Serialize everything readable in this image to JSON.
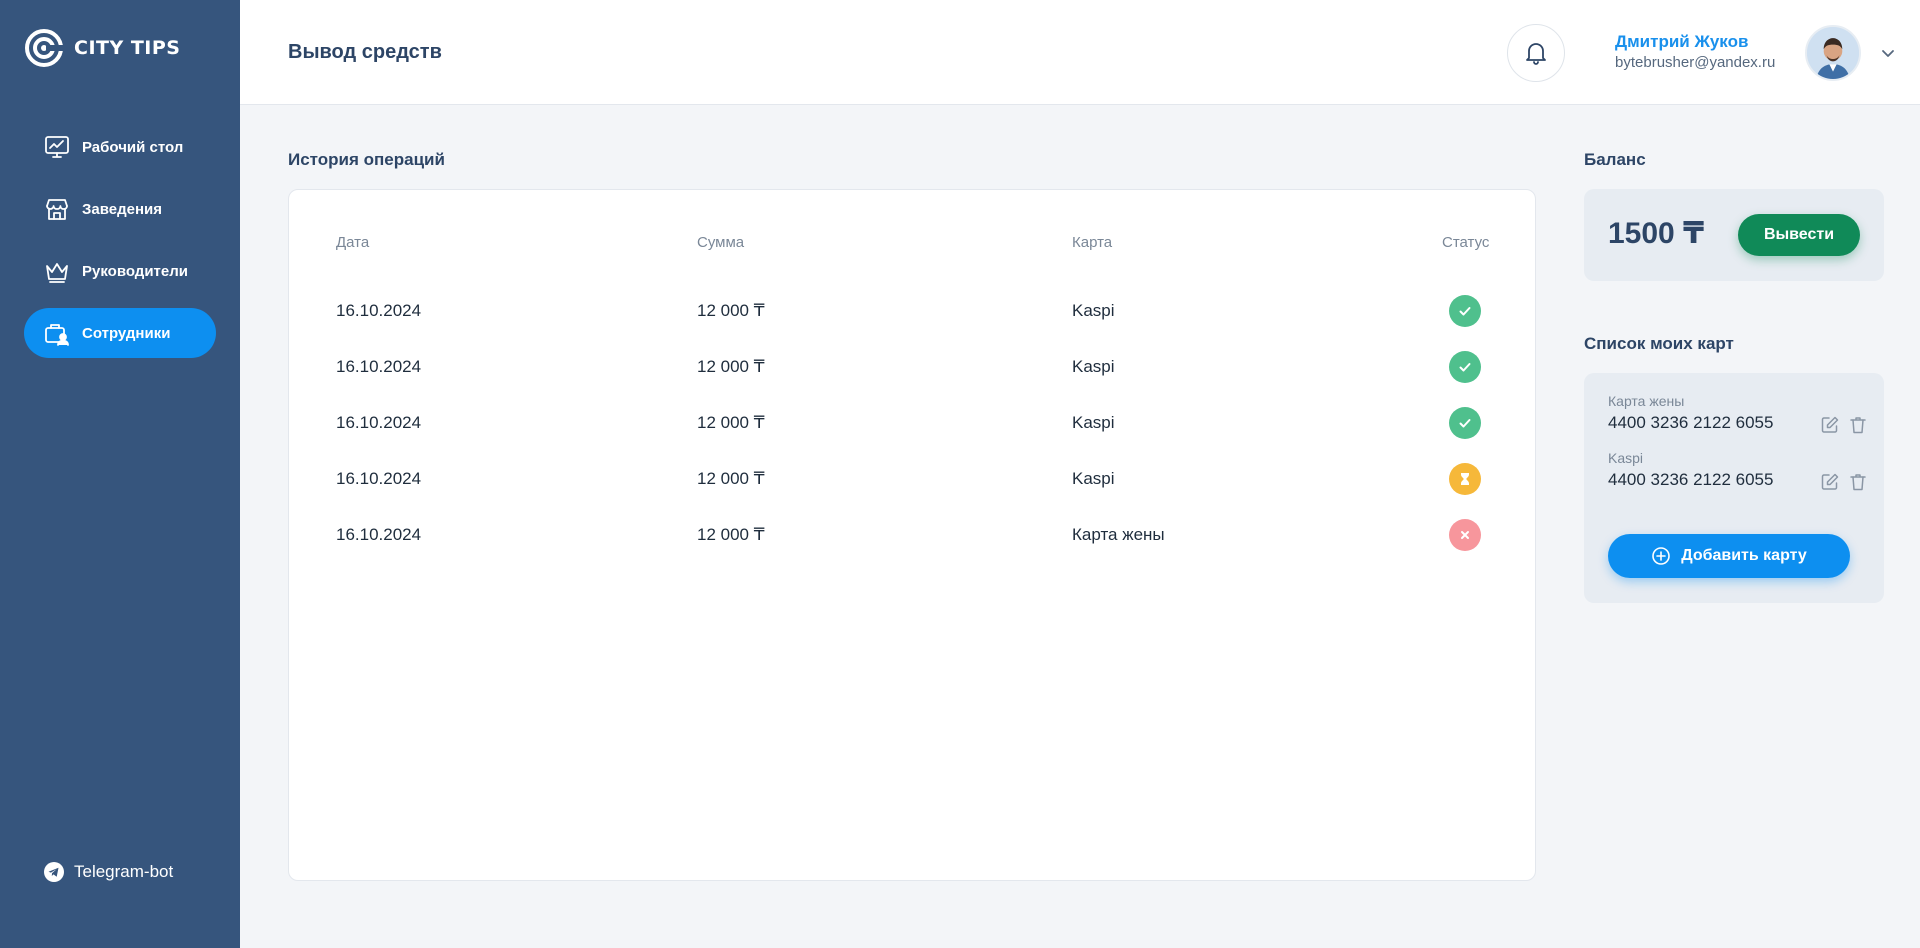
{
  "app": {
    "brand": "CITY TIPS"
  },
  "sidebar": {
    "items": [
      {
        "label": "Рабочий стол",
        "icon": "chart-monitor-icon",
        "active": false
      },
      {
        "label": "Заведения",
        "icon": "store-icon",
        "active": false
      },
      {
        "label": "Руководители",
        "icon": "crown-icon",
        "active": false
      },
      {
        "label": "Сотрудники",
        "icon": "employees-icon",
        "active": true
      }
    ],
    "telegram": {
      "label": "Telegram-bot",
      "icon": "telegram-icon"
    }
  },
  "header": {
    "title": "Вывод средств",
    "notifications_icon": "bell-icon",
    "user": {
      "name": "Дмитрий Жуков",
      "email": "bytebrusher@yandex.ru",
      "menu_icon": "chevron-down-icon"
    }
  },
  "history": {
    "title": "История операций",
    "columns": [
      "Дата",
      "Сумма",
      "Карта",
      "Статус"
    ],
    "rows": [
      {
        "date": "16.10.2024",
        "amount": "12 000 ₸",
        "card": "Kaspi",
        "status": "success"
      },
      {
        "date": "16.10.2024",
        "amount": "12 000 ₸",
        "card": "Kaspi",
        "status": "success"
      },
      {
        "date": "16.10.2024",
        "amount": "12 000 ₸",
        "card": "Kaspi",
        "status": "success"
      },
      {
        "date": "16.10.2024",
        "amount": "12 000 ₸",
        "card": "Kaspi",
        "status": "pending"
      },
      {
        "date": "16.10.2024",
        "amount": "12 000 ₸",
        "card": "Карта жены",
        "status": "failed"
      }
    ]
  },
  "balance": {
    "title": "Баланс",
    "amount": "1500 ₸",
    "withdraw_label": "Вывести"
  },
  "cards": {
    "title": "Список моих карт",
    "items": [
      {
        "label": "Карта жены",
        "number": "4400 3236 2122 6055"
      },
      {
        "label": "Kaspi",
        "number": "4400 3236 2122 6055"
      }
    ],
    "add_label": "Добавить карту"
  },
  "colors": {
    "sidebar": "#36557d",
    "accent": "#0d8ff0",
    "withdraw": "#108a58",
    "status_success": "#4fc08d",
    "status_pending": "#f6b83a",
    "status_failed": "#f7969c"
  }
}
